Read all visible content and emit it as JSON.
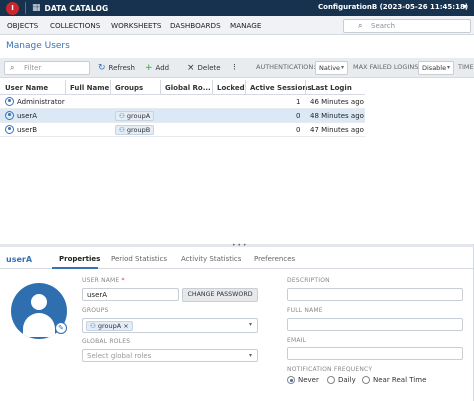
{
  "app": {
    "title": "DATA CATALOG",
    "logo_text": "I",
    "configuration": "ConfigurationB (2023-05-26 11:45:18)"
  },
  "menu": {
    "items": [
      "OBJECTS",
      "COLLECTIONS",
      "WORKSHEETS",
      "DASHBOARDS",
      "MANAGE"
    ],
    "search_placeholder": "Search"
  },
  "page": {
    "title": "Manage Users"
  },
  "toolbar": {
    "filter_placeholder": "Filter",
    "refresh": "Refresh",
    "add": "Add",
    "delete": "Delete",
    "authentication_label": "AUTHENTICATION:",
    "authentication_value": "Native",
    "max_failed_label": "MAX FAILED LOGINS:",
    "max_failed_value": "Disable",
    "time_label": "TIME"
  },
  "grid": {
    "columns": [
      "User Name",
      "Full Name",
      "Groups",
      "Global Ro...",
      "Locked",
      "Active Sessions",
      "Last Login"
    ],
    "rows": [
      {
        "user": "Administrator",
        "full": "",
        "group": "",
        "sessions": "1",
        "last": "46 Minutes ago"
      },
      {
        "user": "userA",
        "full": "",
        "group": "groupA",
        "sessions": "0",
        "last": "48 Minutes ago"
      },
      {
        "user": "userB",
        "full": "",
        "group": "groupB",
        "sessions": "0",
        "last": "47 Minutes ago"
      }
    ]
  },
  "detail": {
    "user": "userA",
    "tabs": [
      "Properties",
      "Period Statistics",
      "Activity Statistics",
      "Preferences"
    ],
    "user_name_label": "USER NAME",
    "required_mark": "*",
    "user_name_value": "userA",
    "change_password": "CHANGE PASSWORD",
    "groups_label": "GROUPS",
    "group_chip": "groupA",
    "global_roles_label": "GLOBAL ROLES",
    "global_roles_placeholder": "Select global roles",
    "description_label": "DESCRIPTION",
    "full_name_label": "FULL NAME",
    "email_label": "EMAIL",
    "notification_label": "NOTIFICATION FREQUENCY",
    "notification_options": [
      "Never",
      "Daily",
      "Near Real Time"
    ],
    "notification_selected": "Never"
  }
}
